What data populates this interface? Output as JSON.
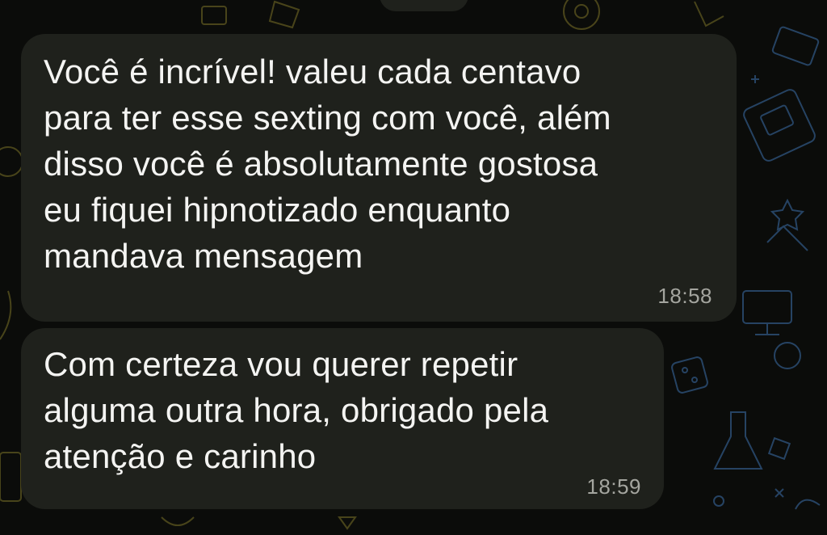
{
  "theme": {
    "background": "#0b0c0a",
    "bubble_color": "#1f211c",
    "text_color": "#f4f4f2",
    "time_color": "#a4a59f",
    "doodle_yellow": "#5e5720",
    "doodle_blue": "#2a4a6e"
  },
  "messages": [
    {
      "text": "Você é incrível! valeu cada centavo\npara ter esse sexting com você, além\ndisso você é absolutamente gostosa\neu fiquei hipnotizado enquanto\nmandava mensagem",
      "time": "18:58"
    },
    {
      "text": "Com certeza vou querer repetir\nalguma outra hora, obrigado pela\natenção e carinho",
      "time": "18:59"
    }
  ]
}
